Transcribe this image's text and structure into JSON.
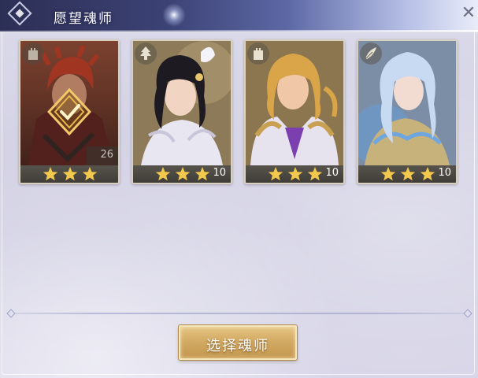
{
  "header": {
    "title": "愿望魂师",
    "close_icon": "close-icon"
  },
  "cards": [
    {
      "id": "card-1",
      "level": "26",
      "stars": 3,
      "selected": true,
      "type_icon": "tower-icon",
      "palette": {
        "bg": "#7a3b2c",
        "hair": "#c23a22",
        "skin": "#d89a78",
        "cloth": "#5a1e1c"
      }
    },
    {
      "id": "card-2",
      "level": "10",
      "stars": 3,
      "selected": false,
      "type_icon": "tree-icon",
      "palette": {
        "bg": "#8c7a58",
        "hair": "#1e1a22",
        "skin": "#f2d4c2",
        "cloth": "#e8e6f0"
      }
    },
    {
      "id": "card-3",
      "level": "10",
      "stars": 3,
      "selected": false,
      "type_icon": "tower-icon",
      "palette": {
        "bg": "#8c7650",
        "hair": "#d9a548",
        "skin": "#f0c8a8",
        "cloth": "#7b3fb0"
      }
    },
    {
      "id": "card-4",
      "level": "10",
      "stars": 3,
      "selected": false,
      "type_icon": "feather-icon",
      "palette": {
        "bg": "#7c8ea6",
        "hair": "#c8d9f2",
        "skin": "#f2dcd2",
        "cloth": "#6fa6e0"
      }
    }
  ],
  "actions": {
    "select_label": "选择魂师"
  },
  "colors": {
    "star": "#f2c94c",
    "button_gold": "#d2aa63",
    "header_dark": "#2c2f55"
  }
}
